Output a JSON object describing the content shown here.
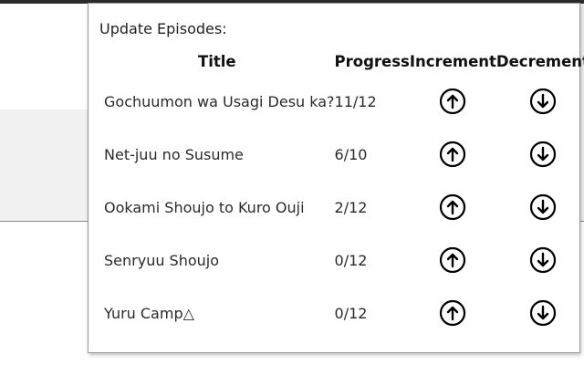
{
  "popup": {
    "title": "Update Episodes:",
    "columns": {
      "title": "Title",
      "progress": "Progress",
      "increment": "Increment",
      "decrement": "Decrement"
    },
    "rows": [
      {
        "title": "Gochuumon wa Usagi Desu ka?",
        "progress": "11/12"
      },
      {
        "title": "Net-juu no Susume",
        "progress": "6/10"
      },
      {
        "title": "Ookami Shoujo to Kuro Ouji",
        "progress": "2/12"
      },
      {
        "title": "Senryuu Shoujo",
        "progress": "0/12"
      },
      {
        "title": "Yuru Camp△",
        "progress": "0/12"
      }
    ],
    "icons": {
      "increment": "arrow-up-circle-icon",
      "decrement": "arrow-down-circle-icon"
    }
  }
}
